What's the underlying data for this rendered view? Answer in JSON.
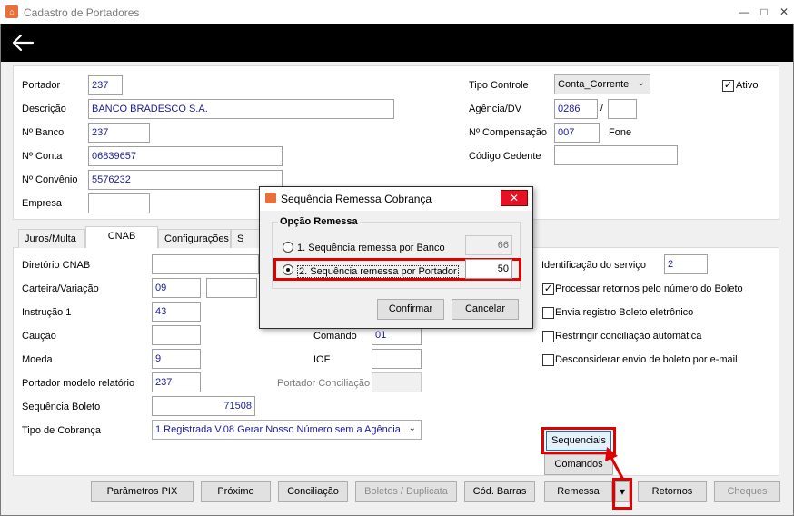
{
  "window": {
    "title": "Cadastro de Portadores",
    "minimize": "—",
    "maximize": "□",
    "close": "✕",
    "app_icon": "app-logo-icon"
  },
  "toolbar": {
    "back_icon": "arrow-left-icon"
  },
  "top": {
    "portador_label": "Portador",
    "portador_value": "237",
    "descricao_label": "Descrição",
    "descricao_value": "BANCO BRADESCO S.A.",
    "nbanco_label": "Nº Banco",
    "nbanco_value": "237",
    "nconta_label": "Nº Conta",
    "nconta_value": "06839657",
    "nconvenio_label": "Nº Convênio",
    "nconvenio_value": "5576232",
    "empresa_label": "Empresa",
    "empresa_value": "",
    "tipo_controle_label": "Tipo Controle",
    "tipo_controle_value": "Conta_Corrente",
    "ativo_label": "Ativo",
    "ativo_checked": "✓",
    "agencia_label": "Agência/DV",
    "agencia_value": "0286",
    "agencia_sep": "/",
    "agencia_dv": "",
    "ncompensacao_label": "Nº Compensação",
    "ncompensacao_value": "007",
    "fone_label": "Fone",
    "codigo_cedente_label": "Código Cedente",
    "codigo_cedente_value": ""
  },
  "tabs": [
    {
      "label": "Juros/Multa"
    },
    {
      "label": "CNAB"
    },
    {
      "label": "Configurações"
    },
    {
      "label": "S"
    }
  ],
  "cnab": {
    "diretorio_label": "Diretório CNAB",
    "diretorio_value": "",
    "carteira_label": "Carteira/Variação",
    "carteira_value": "09",
    "variacao_value": "",
    "instrucao_label": "Instrução 1",
    "instrucao_value": "43",
    "caucao_label": "Caução",
    "caucao_value": "",
    "moeda_label": "Moeda",
    "moeda_value": "9",
    "portador_rel_label": "Portador modelo relatório",
    "portador_rel_value": "237",
    "sequencia_boleto_label": "Sequência Boleto",
    "sequencia_boleto_value": "71508",
    "tipo_cobranca_label": "Tipo de Cobrança",
    "tipo_cobranca_value": "1.Registrada V.08 Gerar Nosso Número sem a Agência",
    "comando_label": "Comando",
    "comando_value": "01",
    "iof_label": "IOF",
    "iof_value": "",
    "portador_conc_label": "Portador Conciliação",
    "portador_conc_value": "",
    "ident_servico_label": "Identificação do serviço",
    "ident_servico_value": "2",
    "checks": [
      {
        "label": "Processar retornos pelo número do Boleto",
        "mark": "✓"
      },
      {
        "label": "Envia registro Boleto eletrônico",
        "mark": ""
      },
      {
        "label": "Restringir conciliação automática",
        "mark": ""
      },
      {
        "label": "Desconsiderar envio de boleto por e-mail",
        "mark": ""
      }
    ],
    "sequenciais_button": "Sequenciais",
    "comandos_button": "Comandos"
  },
  "buttons": {
    "parametros_pix": "Parâmetros PIX",
    "proximo": "Próximo",
    "conciliacao": "Conciliação",
    "boletos_duplicata": "Boletos / Duplicata",
    "cod_barras": "Cód. Barras",
    "remessa": "Remessa",
    "remessa_dropdown": "▾",
    "retornos": "Retornos",
    "cheques": "Cheques"
  },
  "dialog": {
    "title": "Sequência Remessa Cobrança",
    "close": "✕",
    "group_label": "Opção Remessa",
    "option1_label": "1. Sequência remessa por Banco",
    "option1_value": "66",
    "option2_label": "2. Sequência remessa por Portador",
    "option2_value": "50",
    "confirmar": "Confirmar",
    "cancelar": "Cancelar"
  },
  "colors": {
    "highlight": "#e00000",
    "field_text": "#1a1a9a",
    "toolbar": "#000000"
  }
}
